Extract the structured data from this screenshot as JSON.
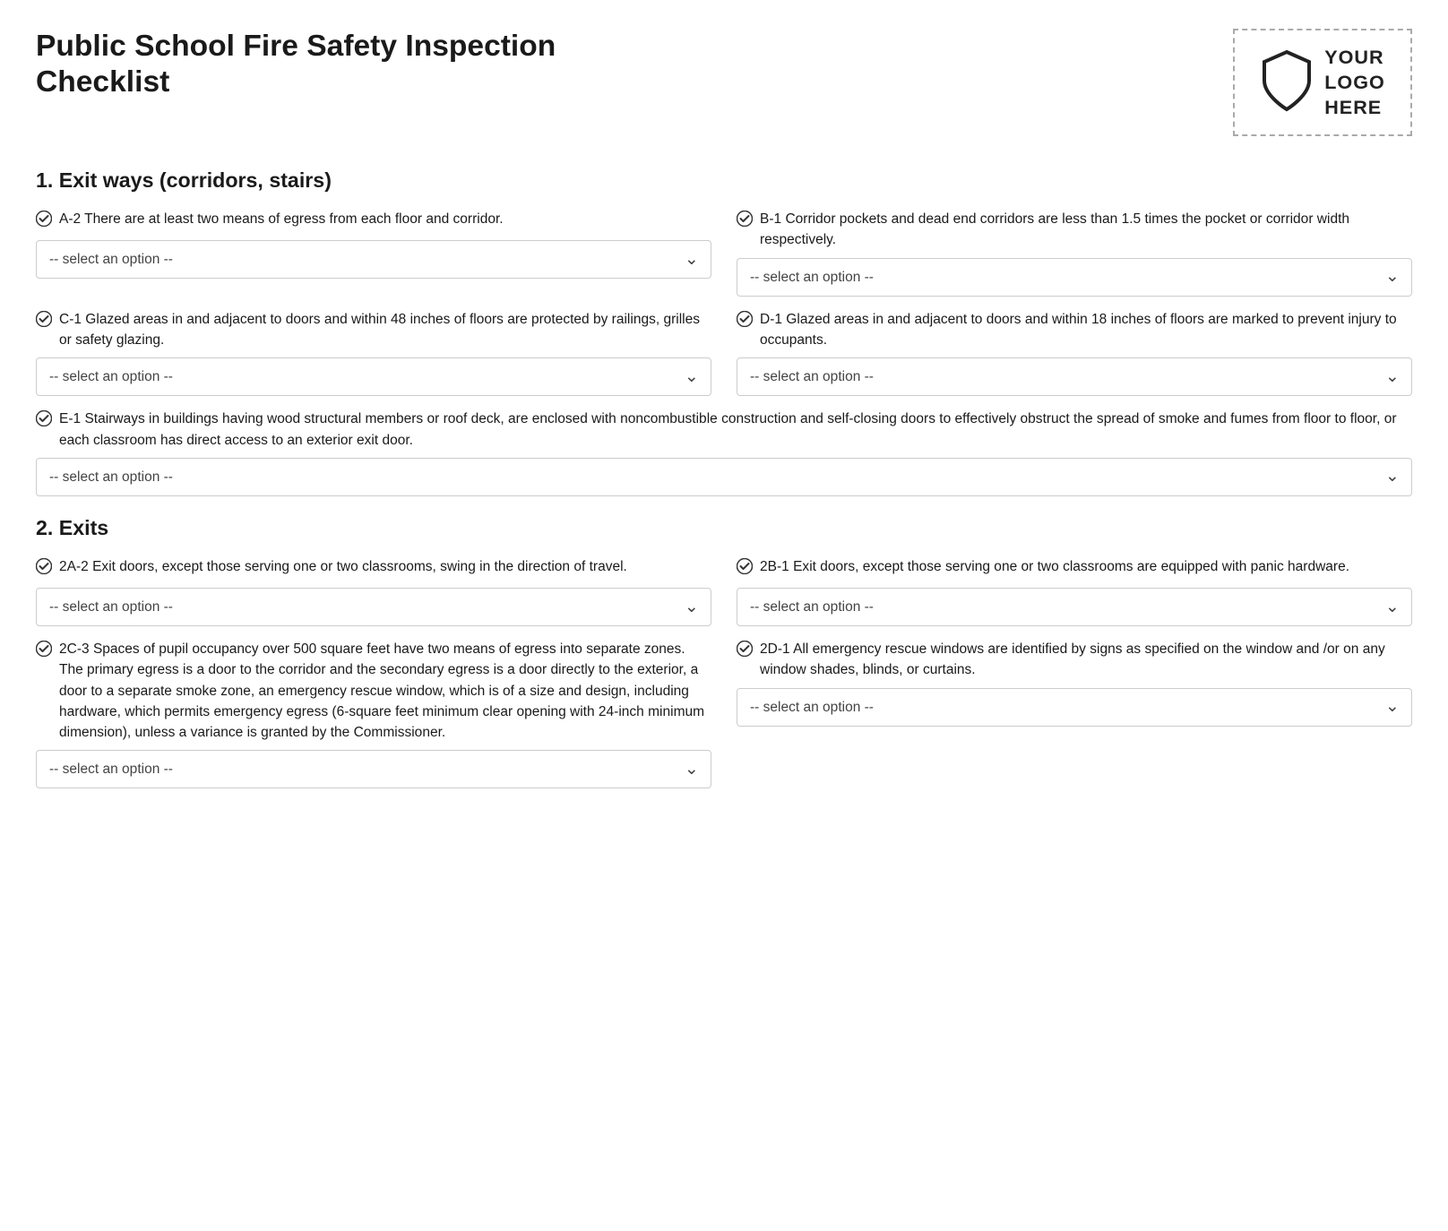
{
  "page": {
    "title": "Public School Fire Safety Inspection Checklist",
    "logo_text": "YOUR\nLOGO\nHERE",
    "select_placeholder": "-- select an option --"
  },
  "sections": [
    {
      "id": "section-1",
      "number": "1",
      "title": "Exit ways (corridors, stairs)",
      "items": [
        {
          "id": "A2",
          "col": "left",
          "text": "A-2 There are at least two means of egress from each floor and corridor."
        },
        {
          "id": "B1",
          "col": "right",
          "text": "B-1 Corridor pockets and dead end corridors are less than 1.5 times the pocket or corridor width respectively."
        },
        {
          "id": "C1",
          "col": "left",
          "text": "C-1 Glazed areas in and adjacent to doors and within 48 inches of floors are protected by railings, grilles or safety glazing."
        },
        {
          "id": "D1",
          "col": "right",
          "text": "D-1 Glazed areas in and adjacent to doors and within 18 inches of floors are marked to prevent injury to occupants."
        },
        {
          "id": "E1",
          "col": "full",
          "text": "E-1 Stairways in buildings having wood structural members or roof deck, are enclosed with noncombustible construction and self-closing doors to effectively obstruct the spread of smoke and fumes from floor to floor, or each classroom has direct access to an exterior exit door."
        }
      ]
    },
    {
      "id": "section-2",
      "number": "2",
      "title": "Exits",
      "items": [
        {
          "id": "2A2",
          "col": "left",
          "text": "2A-2 Exit doors, except those serving one or two classrooms, swing in the direction of travel."
        },
        {
          "id": "2B1",
          "col": "right",
          "text": "2B-1 Exit doors, except those serving one or two classrooms are equipped with panic hardware."
        },
        {
          "id": "2C3",
          "col": "left",
          "text": "2C-3 Spaces of pupil occupancy over 500 square feet have two means of egress into separate zones. The primary egress is a door to the corridor and the secondary egress is a door directly to the exterior, a door to a separate smoke zone, an emergency rescue window, which is of a size and design, including hardware, which permits emergency egress (6-square feet minimum clear opening with 24-inch minimum dimension), unless a variance is granted by the Commissioner."
        },
        {
          "id": "2D1",
          "col": "right",
          "text": "2D-1 All emergency rescue windows are identified by signs as specified on the window and /or on any window shades, blinds, or curtains."
        }
      ]
    }
  ]
}
